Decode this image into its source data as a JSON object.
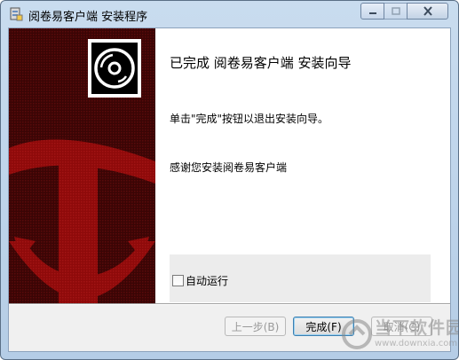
{
  "window": {
    "title": "阅卷易客户端 安装程序",
    "controls": {
      "minimize_icon": "minimize-icon",
      "maximize_icon": "maximize-icon",
      "close_icon": "close-icon"
    }
  },
  "main": {
    "heading": "已完成 阅卷易客户端 安装向导",
    "line1": "单击\"完成\"按钮以退出安装向导。",
    "line2": "感谢您安装阅卷易客户端",
    "checkbox_label": "自动运行",
    "checkbox_checked": false
  },
  "footer": {
    "back_label": "上一步(B)",
    "finish_label": "完成(F)",
    "cancel_label": "取消(C)"
  },
  "watermark": {
    "text": "当下软件园",
    "url": "www.downxia.com"
  },
  "colors": {
    "sidebar_dark": "#3a0505",
    "sidebar_red": "#8e0a0a",
    "accent_blue": "#3c7fb1"
  }
}
